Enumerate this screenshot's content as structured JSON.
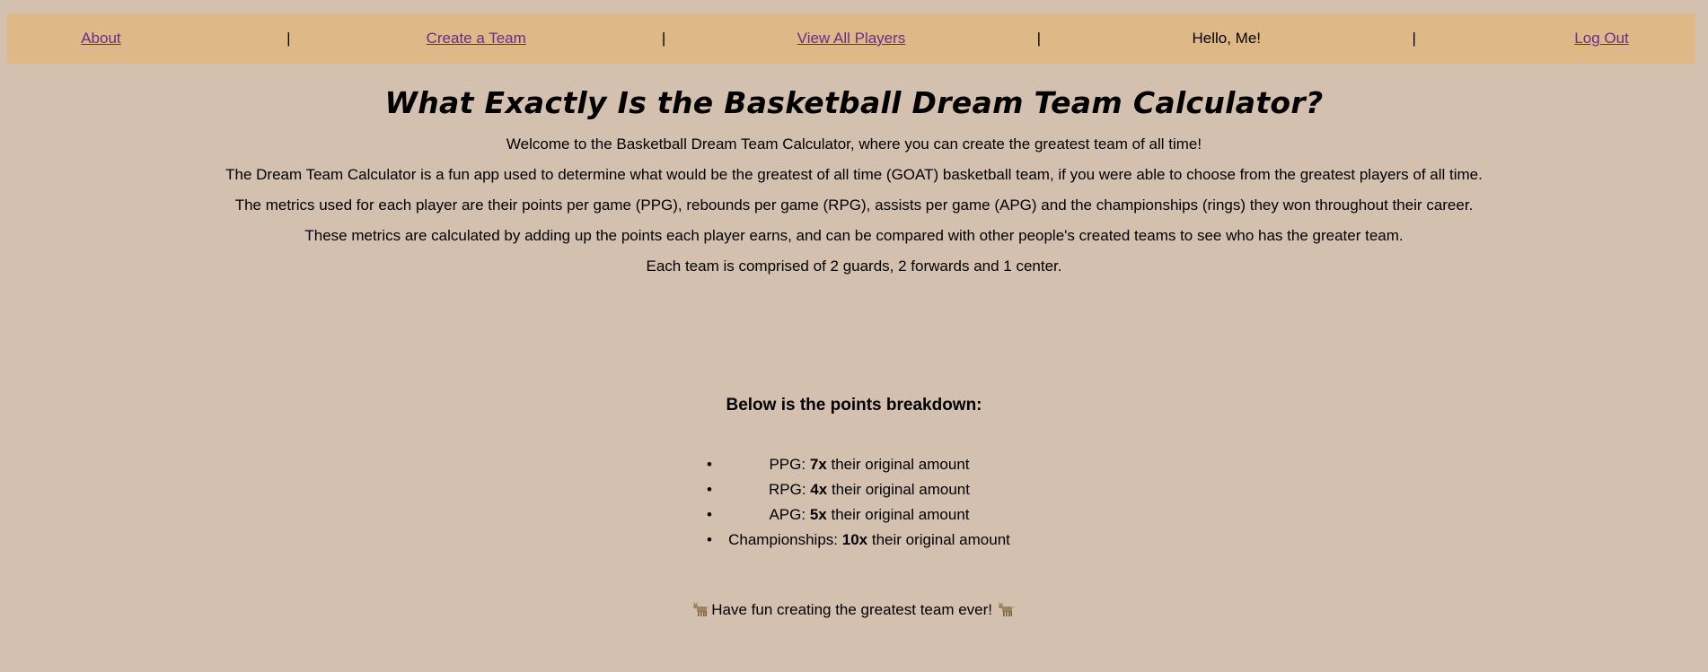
{
  "nav": {
    "items": [
      {
        "type": "link",
        "label": "About"
      },
      {
        "type": "sep",
        "label": "|"
      },
      {
        "type": "link",
        "label": "Create a Team"
      },
      {
        "type": "sep",
        "label": "|"
      },
      {
        "type": "link",
        "label": "View All Players"
      },
      {
        "type": "sep",
        "label": "|"
      },
      {
        "type": "text",
        "label": "Hello, Me!"
      },
      {
        "type": "sep",
        "label": "|"
      },
      {
        "type": "link",
        "label": "Log Out"
      }
    ]
  },
  "main": {
    "title": "What Exactly Is the Basketball Dream Team Calculator?",
    "paragraphs": [
      "Welcome to the Basketball Dream Team Calculator, where you can create the greatest team of all time!",
      "The Dream Team Calculator is a fun app used to determine what would be the greatest of all time (GOAT) basketball team, if you were able to choose from the greatest players of all time.",
      "The metrics used for each player are their points per game (PPG), rebounds per game (RPG), assists per game (APG) and the championships (rings) they won throughout their career.",
      "These metrics are calculated by adding up the points each player earns, and can be compared with other people's created teams to see who has the greater team.",
      "Each team is comprised of 2 guards, 2 forwards and 1 center."
    ],
    "breakdown_title": "Below is the points breakdown:",
    "breakdown": [
      {
        "metric": "PPG:",
        "multiplier": "7x",
        "suffix": "their original amount"
      },
      {
        "metric": "RPG:",
        "multiplier": "4x",
        "suffix": "their original amount"
      },
      {
        "metric": "APG:",
        "multiplier": "5x",
        "suffix": "their original amount"
      },
      {
        "metric": "Championships:",
        "multiplier": "10x",
        "suffix": "their original amount"
      }
    ],
    "closing": "Have fun creating the greatest team ever!",
    "closing_icon": "goat-icon"
  },
  "colors": {
    "page_background": "#d3c0ae",
    "nav_background": "#deb887",
    "link": "#6b2b8f"
  }
}
